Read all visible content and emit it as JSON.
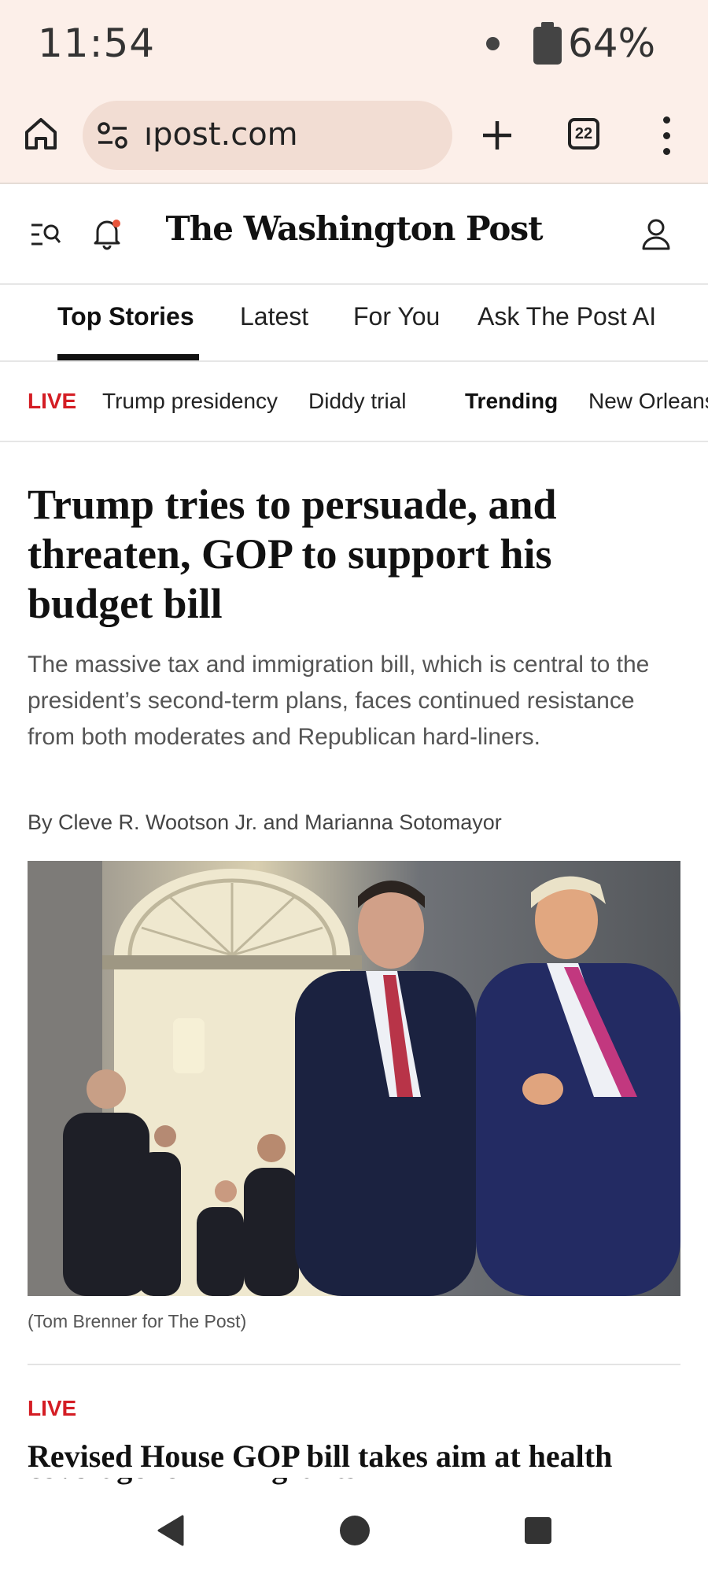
{
  "status_bar": {
    "time": "11:54",
    "battery_percent": "64%"
  },
  "browser": {
    "url": "ıpost.com",
    "tab_count": "22",
    "icons": [
      "home-icon",
      "site-settings-icon",
      "plus-icon",
      "tabs-icon",
      "more-vert-icon"
    ]
  },
  "site": {
    "logo": "The Washington Post",
    "icons": [
      "search-menu-icon",
      "bell-icon",
      "account-icon"
    ],
    "accent_color": "#d41d24"
  },
  "section_tabs": [
    {
      "label": "Top Stories",
      "active": true
    },
    {
      "label": "Latest",
      "active": false
    },
    {
      "label": "For You",
      "active": false
    },
    {
      "label": "Ask The Post AI",
      "active": false
    }
  ],
  "topic_bar": {
    "live": "LIVE",
    "items": [
      "Trump presidency",
      "Diddy trial"
    ],
    "trending": "Trending",
    "trending_items": [
      "New Orleans"
    ]
  },
  "story": {
    "headline": "Trump tries to persuade, and threaten, GOP to support his budget bill",
    "dek": "The massive tax and immigration bill, which is central to the president’s second-term plans, faces continued resistance from both moderates and Republican hard-liners.",
    "byline": "By Cleve R. Wootson Jr. and Marianna Sotomayor",
    "caption": "(Tom Brenner for The Post)"
  },
  "next_story": {
    "label": "LIVE",
    "headline": "Revised House GOP bill takes aim at health",
    "headline_cont": "coverage for immigrants"
  },
  "nav_bar": {
    "icons": [
      "back-icon",
      "home-circle-icon",
      "recents-icon"
    ]
  }
}
